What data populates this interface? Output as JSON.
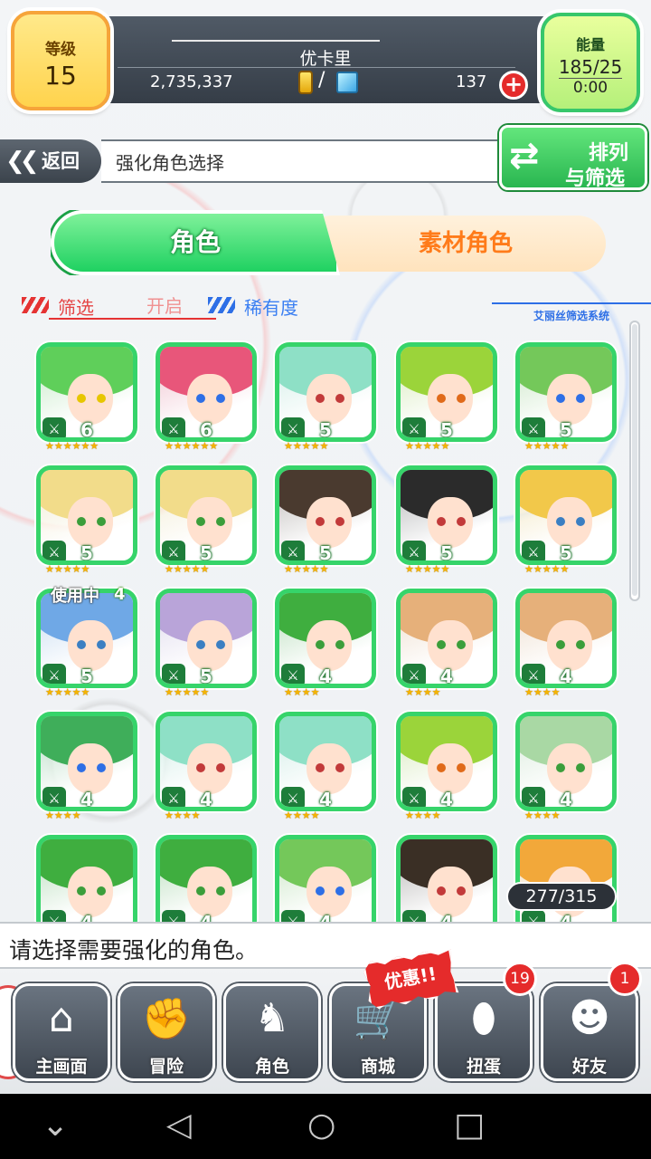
{
  "status": {
    "level_label": "等级",
    "level_value": "15",
    "player_name": "优卡里",
    "gold": "2,735,337",
    "currency_slash": "/",
    "gems": "137",
    "plus": "+",
    "energy_label": "能量",
    "energy_value": "185/25",
    "energy_timer": "0:00"
  },
  "header": {
    "back_label": "返回",
    "back_chevron": "❮❮",
    "title": "强化角色选择",
    "sort_line1": "排列",
    "sort_line2": "与筛选"
  },
  "tabs": {
    "character": "角色",
    "material": "素材角色"
  },
  "filter": {
    "label": "筛选",
    "state": "开启",
    "rarity": "稀有度",
    "system": "艾丽丝筛选系统"
  },
  "characters": [
    {
      "rarity": "6",
      "stars": "★★★★★★",
      "hair": "#5fcf5a",
      "eye": "#e7c600"
    },
    {
      "rarity": "6",
      "stars": "★★★★★★",
      "hair": "#e8567a",
      "eye": "#2e6fe6"
    },
    {
      "rarity": "5",
      "stars": "★★★★★",
      "hair": "#8ee0c6",
      "eye": "#c23a3a"
    },
    {
      "rarity": "5",
      "stars": "★★★★★",
      "hair": "#9bd43a",
      "eye": "#e06a1a"
    },
    {
      "rarity": "5",
      "stars": "★★★★★",
      "hair": "#74c85a",
      "eye": "#2e6fe6"
    },
    {
      "rarity": "5",
      "stars": "★★★★★",
      "hair": "#f2dc8a",
      "eye": "#3b9e3b"
    },
    {
      "rarity": "5",
      "stars": "★★★★★",
      "hair": "#f2dc8a",
      "eye": "#3b9e3b"
    },
    {
      "rarity": "5",
      "stars": "★★★★★",
      "hair": "#4a3a2f",
      "eye": "#c23a3a"
    },
    {
      "rarity": "5",
      "stars": "★★★★★",
      "hair": "#2b2b2b",
      "eye": "#c23a3a"
    },
    {
      "rarity": "5",
      "stars": "★★★★★",
      "hair": "#f2c84a",
      "eye": "#3b7fc2"
    },
    {
      "rarity": "5",
      "stars": "★★★★★",
      "hair": "#6fa8e6",
      "eye": "#3b7fc2",
      "inuse": "使用中",
      "inuse_n": "4"
    },
    {
      "rarity": "5",
      "stars": "★★★★★",
      "hair": "#b9a4d9",
      "eye": "#3b7fc2"
    },
    {
      "rarity": "4",
      "stars": "★★★★",
      "hair": "#3fae3f",
      "eye": "#3b9e3b"
    },
    {
      "rarity": "4",
      "stars": "★★★★",
      "hair": "#e6b07a",
      "eye": "#3b9e3b"
    },
    {
      "rarity": "4",
      "stars": "★★★★",
      "hair": "#e6b07a",
      "eye": "#3b9e3b"
    },
    {
      "rarity": "4",
      "stars": "★★★★",
      "hair": "#3fae5a",
      "eye": "#2e6fe6"
    },
    {
      "rarity": "4",
      "stars": "★★★★",
      "hair": "#8ee0c6",
      "eye": "#c23a3a"
    },
    {
      "rarity": "4",
      "stars": "★★★★",
      "hair": "#8ee0c6",
      "eye": "#c23a3a"
    },
    {
      "rarity": "4",
      "stars": "★★★★",
      "hair": "#9bd43a",
      "eye": "#e06a1a"
    },
    {
      "rarity": "4",
      "stars": "★★★★",
      "hair": "#a9d8a4",
      "eye": "#3b9e3b"
    },
    {
      "rarity": "4",
      "stars": "★★★★",
      "hair": "#3fae3f",
      "eye": "#3b9e3b"
    },
    {
      "rarity": "4",
      "stars": "★★★★",
      "hair": "#3fae3f",
      "eye": "#3b9e3b"
    },
    {
      "rarity": "4",
      "stars": "★★★★",
      "hair": "#74c85a",
      "eye": "#2e6fe6"
    },
    {
      "rarity": "4",
      "stars": "★★★★",
      "hair": "#3a2f25",
      "eye": "#c23a3a"
    },
    {
      "rarity": "4",
      "stars": "★★★★",
      "hair": "#f2a83a",
      "eye": "#3b7fc2"
    }
  ],
  "count": "277/315",
  "message": "请选择需要强化的角色。",
  "nav": {
    "toggle": "›",
    "home": "主画面",
    "adventure": "冒险",
    "character": "角色",
    "shop": "商城",
    "gacha": "扭蛋",
    "friends": "好友",
    "promo": "优惠!!",
    "gacha_badge": "19",
    "friends_badge": "1"
  },
  "system_nav": {
    "down": "⌄",
    "back": "◁",
    "home": "○",
    "recent": "□"
  },
  "colors": {
    "accent_green": "#36d46a",
    "level_gold": "#ffd34d",
    "alert_red": "#e52b2b"
  }
}
